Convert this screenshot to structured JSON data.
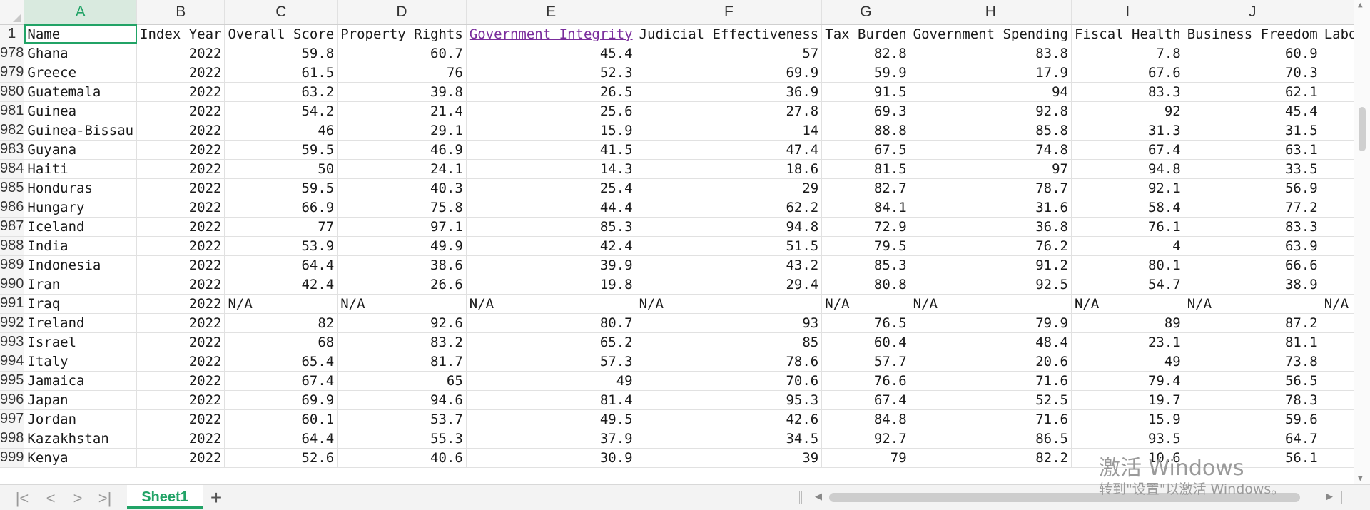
{
  "columns": [
    "A",
    "B",
    "C",
    "D",
    "E",
    "F",
    "G",
    "H",
    "I",
    "J",
    ""
  ],
  "header_row": {
    "row_number": "1",
    "cells": [
      "Name",
      "Index Year",
      "Overall Score",
      "Property Rights",
      "Government Integrity",
      "Judicial Effectiveness",
      "Tax Burden",
      "Government Spending",
      "Fiscal Health",
      "Business Freedom",
      "Labor Freedom"
    ]
  },
  "rows": [
    {
      "n": "978",
      "cells": [
        "Ghana",
        "2022",
        "59.8",
        "60.7",
        "45.4",
        "57",
        "82.8",
        "83.8",
        "7.8",
        "60.9",
        ""
      ]
    },
    {
      "n": "979",
      "cells": [
        "Greece",
        "2022",
        "61.5",
        "76",
        "52.3",
        "69.9",
        "59.9",
        "17.9",
        "67.6",
        "70.3",
        ""
      ]
    },
    {
      "n": "980",
      "cells": [
        "Guatemala",
        "2022",
        "63.2",
        "39.8",
        "26.5",
        "36.9",
        "91.5",
        "94",
        "83.3",
        "62.1",
        ""
      ]
    },
    {
      "n": "981",
      "cells": [
        "Guinea",
        "2022",
        "54.2",
        "21.4",
        "25.6",
        "27.8",
        "69.3",
        "92.8",
        "92",
        "45.4",
        ""
      ]
    },
    {
      "n": "982",
      "cells": [
        "Guinea-Bissau",
        "2022",
        "46",
        "29.1",
        "15.9",
        "14",
        "88.8",
        "85.8",
        "31.3",
        "31.5",
        ""
      ]
    },
    {
      "n": "983",
      "cells": [
        "Guyana",
        "2022",
        "59.5",
        "46.9",
        "41.5",
        "47.4",
        "67.5",
        "74.8",
        "67.4",
        "63.1",
        ""
      ]
    },
    {
      "n": "984",
      "cells": [
        "Haiti",
        "2022",
        "50",
        "24.1",
        "14.3",
        "18.6",
        "81.5",
        "97",
        "94.8",
        "33.5",
        ""
      ]
    },
    {
      "n": "985",
      "cells": [
        "Honduras",
        "2022",
        "59.5",
        "40.3",
        "25.4",
        "29",
        "82.7",
        "78.7",
        "92.1",
        "56.9",
        ""
      ]
    },
    {
      "n": "986",
      "cells": [
        "Hungary",
        "2022",
        "66.9",
        "75.8",
        "44.4",
        "62.2",
        "84.1",
        "31.6",
        "58.4",
        "77.2",
        ""
      ]
    },
    {
      "n": "987",
      "cells": [
        "Iceland",
        "2022",
        "77",
        "97.1",
        "85.3",
        "94.8",
        "72.9",
        "36.8",
        "76.1",
        "83.3",
        ""
      ]
    },
    {
      "n": "988",
      "cells": [
        "India",
        "2022",
        "53.9",
        "49.9",
        "42.4",
        "51.5",
        "79.5",
        "76.2",
        "4",
        "63.9",
        ""
      ]
    },
    {
      "n": "989",
      "cells": [
        "Indonesia",
        "2022",
        "64.4",
        "38.6",
        "39.9",
        "43.2",
        "85.3",
        "91.2",
        "80.1",
        "66.6",
        ""
      ]
    },
    {
      "n": "990",
      "cells": [
        "Iran",
        "2022",
        "42.4",
        "26.6",
        "19.8",
        "29.4",
        "80.8",
        "92.5",
        "54.7",
        "38.9",
        ""
      ]
    },
    {
      "n": "991",
      "cells": [
        "Iraq",
        "2022",
        "N/A",
        "N/A",
        "N/A",
        "N/A",
        "N/A",
        "N/A",
        "N/A",
        "N/A",
        "N/A"
      ]
    },
    {
      "n": "992",
      "cells": [
        "Ireland",
        "2022",
        "82",
        "92.6",
        "80.7",
        "93",
        "76.5",
        "79.9",
        "89",
        "87.2",
        ""
      ]
    },
    {
      "n": "993",
      "cells": [
        "Israel",
        "2022",
        "68",
        "83.2",
        "65.2",
        "85",
        "60.4",
        "48.4",
        "23.1",
        "81.1",
        ""
      ]
    },
    {
      "n": "994",
      "cells": [
        "Italy",
        "2022",
        "65.4",
        "81.7",
        "57.3",
        "78.6",
        "57.7",
        "20.6",
        "49",
        "73.8",
        ""
      ]
    },
    {
      "n": "995",
      "cells": [
        "Jamaica",
        "2022",
        "67.4",
        "65",
        "49",
        "70.6",
        "76.6",
        "71.6",
        "79.4",
        "56.5",
        ""
      ]
    },
    {
      "n": "996",
      "cells": [
        "Japan",
        "2022",
        "69.9",
        "94.6",
        "81.4",
        "95.3",
        "67.4",
        "52.5",
        "19.7",
        "78.3",
        ""
      ]
    },
    {
      "n": "997",
      "cells": [
        "Jordan",
        "2022",
        "60.1",
        "53.7",
        "49.5",
        "42.6",
        "84.8",
        "71.6",
        "15.9",
        "59.6",
        ""
      ]
    },
    {
      "n": "998",
      "cells": [
        "Kazakhstan",
        "2022",
        "64.4",
        "55.3",
        "37.9",
        "34.5",
        "92.7",
        "86.5",
        "93.5",
        "64.7",
        ""
      ]
    },
    {
      "n": "999",
      "cells": [
        "Kenya",
        "2022",
        "52.6",
        "40.6",
        "30.9",
        "39",
        "79",
        "82.2",
        "10.6",
        "56.1",
        ""
      ]
    }
  ],
  "sheet_tabs": [
    "Sheet1"
  ],
  "add_sheet_label": "+",
  "nav": {
    "first": "|<",
    "prev": "<",
    "next": ">",
    "last": ">|"
  },
  "watermark": {
    "line1": "激活 Windows",
    "line2": "转到\"设置\"以激活 Windows。"
  },
  "colors": {
    "accent": "#21a366",
    "link": "#7a2d9c",
    "header_bg": "#f5f5f5",
    "gridline": "#e1e1e1"
  }
}
